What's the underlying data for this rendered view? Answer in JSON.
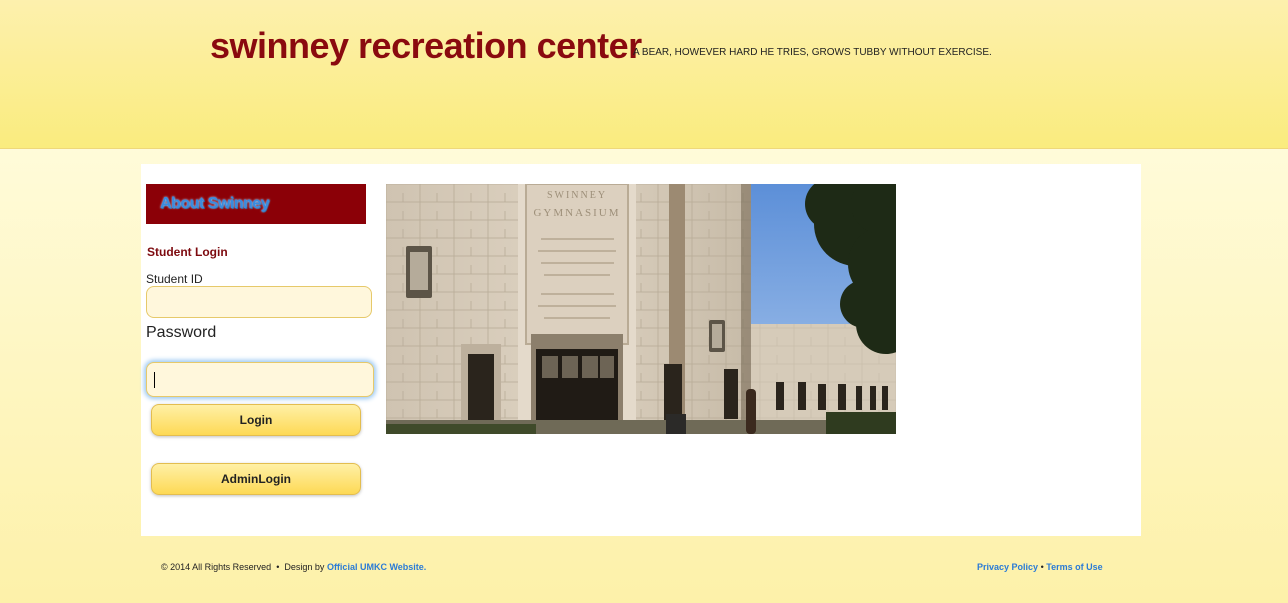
{
  "header": {
    "title": "swinney recreation center",
    "tagline": "A BEAR, HOWEVER HARD HE TRIES, GROWS TUBBY WITHOUT EXERCISE."
  },
  "sidebar": {
    "nav_link": "About Swinney",
    "login_heading": "Student Login",
    "student_id_label": "Student ID",
    "student_id_value": "",
    "password_label": "Password",
    "password_value": "",
    "login_button": "Login",
    "admin_button": "AdminLogin"
  },
  "photo": {
    "inscription_top": "SWINNEY",
    "inscription_bottom": "GYMNASIUM"
  },
  "footer": {
    "copyright": "© 2014 All Rights Reserved",
    "separator": "•",
    "design_by": "Design by",
    "design_link": "Official UMKC Website",
    "design_suffix": ".",
    "privacy": "Privacy Policy",
    "link_sep": "•",
    "terms": "Terms of Use"
  },
  "colors": {
    "title": "#8a0a0f",
    "nav_bg": "#8b0007",
    "link": "#2a7bd6",
    "button": "#fdd955"
  }
}
